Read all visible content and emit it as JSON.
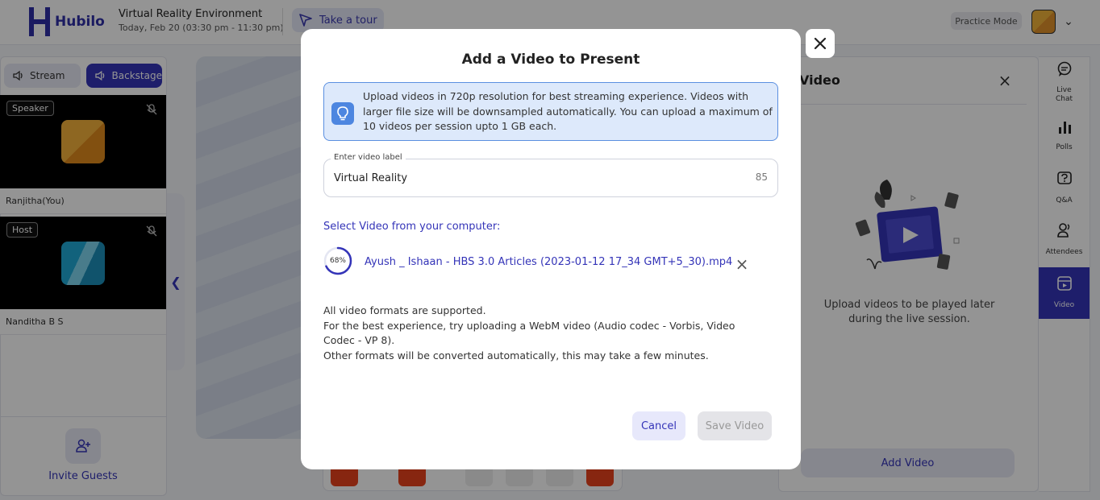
{
  "header": {
    "logo_text": "Hubilo",
    "event_title": "Virtual Reality Environment",
    "event_date": "Today, Feb 20 (03:30 pm - 11:30 pm)",
    "tour_label": "Take a tour",
    "practice_mode": "Practice Mode"
  },
  "left_panel": {
    "tabs": [
      {
        "label": "Stream",
        "icon": "speaker-icon"
      },
      {
        "label": "Backstage",
        "icon": "speaker-icon"
      }
    ],
    "participants": [
      {
        "role": "Speaker",
        "name": "Ranjitha(You)",
        "mic": "mic-off-icon"
      },
      {
        "role": "Host",
        "name": "Nanditha B S",
        "mic": "mic-off-icon"
      }
    ],
    "invite_label": "Invite Guests"
  },
  "right_panel": {
    "title": "Video",
    "hint": "Upload videos to be played later during the live session.",
    "add_button": "Add Video"
  },
  "right_nav": [
    {
      "label": "Live Chat",
      "icon": "chat-icon"
    },
    {
      "label": "Polls",
      "icon": "polls-icon"
    },
    {
      "label": "Q&A",
      "icon": "question-icon"
    },
    {
      "label": "Attendees",
      "icon": "attendees-icon"
    },
    {
      "label": "Video",
      "icon": "video-icon",
      "active": true
    }
  ],
  "modal": {
    "title": "Add a Video to Present",
    "info": "Upload videos in 720p resolution for best streaming experience. Videos with larger file size will be downsampled automatically. You can upload a maximum of 10 videos per session upto 1 GB each.",
    "field_label": "Enter video label",
    "field_value": "Virtual Reality",
    "char_count": "85",
    "select_label": "Select Video from your computer:",
    "upload_progress": 0.68,
    "upload_progress_text": "68%",
    "file_name": "Ayush _ Ishaan - HBS 3.0 Articles (2023-01-12 17_34 GMT+5_30).mp4",
    "notes": [
      "All video formats are supported.",
      "For the best experience, try uploading a WebM video (Audio codec - Vorbis, Video Codec - VP 8).",
      "Other formats will be converted automatically, this may take a few minutes."
    ],
    "cancel_label": "Cancel",
    "save_label": "Save Video"
  },
  "colors": {
    "brand": "#3434b8",
    "info_bg": "#dde9fb",
    "info_border": "#5a8fe0",
    "danger": "#e8421c"
  }
}
